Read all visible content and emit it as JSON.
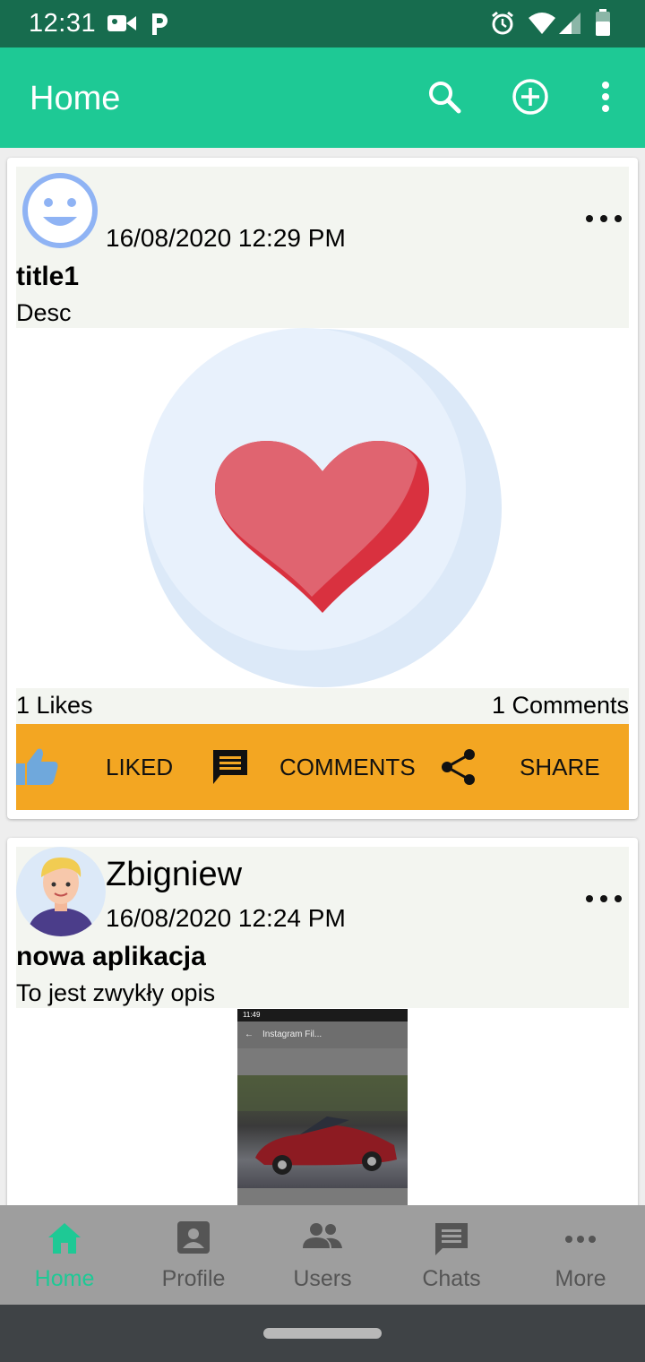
{
  "status_bar": {
    "time": "12:31"
  },
  "app_bar": {
    "title": "Home",
    "icons": [
      "search-icon",
      "add-circle-icon",
      "overflow-menu-icon"
    ]
  },
  "posts": [
    {
      "username": "",
      "date": "16/08/2020 12:29 PM",
      "title": "title1",
      "description": "Desc",
      "likes_text": "1 Likes",
      "comments_text": "1 Comments",
      "actions": {
        "like_label": "LIKED",
        "comments_label": "COMMENTS",
        "share_label": "SHARE"
      },
      "image": "heart-image"
    },
    {
      "username": "Zbigniew",
      "date": "16/08/2020 12:24 PM",
      "title": "nowa aplikacja",
      "description": "To jest zwykły opis",
      "image": "screenshot-image",
      "image_inner": {
        "time": "11:49",
        "title": "Instagram Fil..."
      }
    }
  ],
  "bottom_nav": {
    "items": [
      {
        "label": "Home",
        "icon": "home-icon",
        "active": true
      },
      {
        "label": "Profile",
        "icon": "profile-icon",
        "active": false
      },
      {
        "label": "Users",
        "icon": "users-icon",
        "active": false
      },
      {
        "label": "Chats",
        "icon": "chat-icon",
        "active": false
      },
      {
        "label": "More",
        "icon": "more-icon",
        "active": false
      }
    ]
  },
  "colors": {
    "status_bar": "#176c4e",
    "primary": "#1ec995",
    "action_bar": "#f3a622",
    "bottom_nav": "#9e9e9e",
    "like_icon": "#6fa8dc"
  }
}
